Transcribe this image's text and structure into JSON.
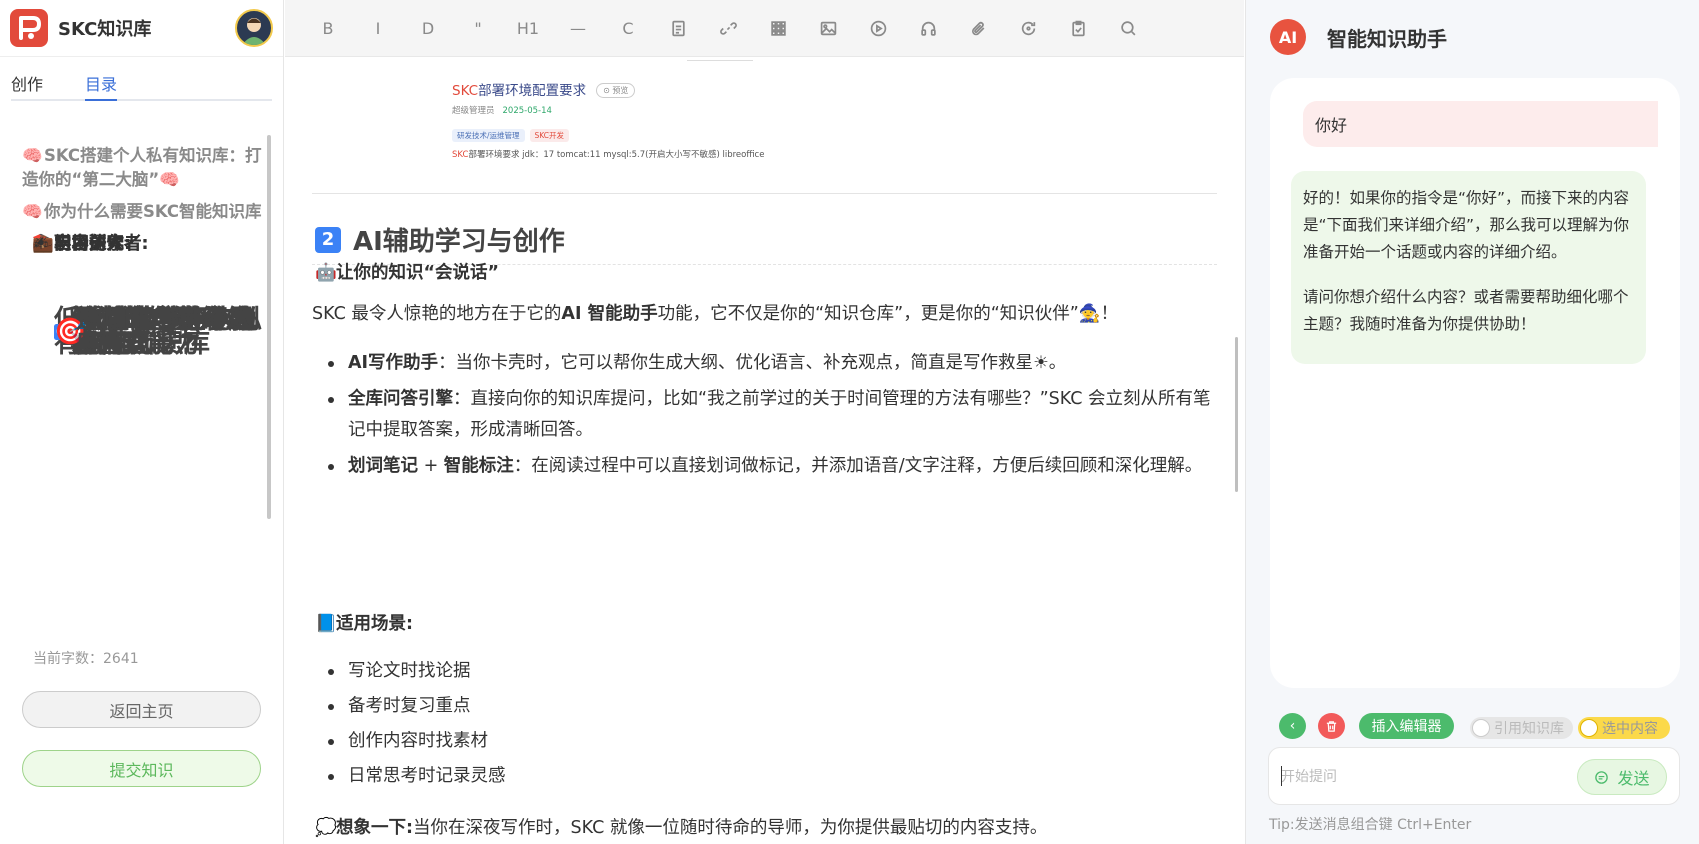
{
  "sidebar": {
    "brand": "SKC知识库",
    "tabs": [
      "创作",
      "目录"
    ],
    "toc": [
      {
        "text": "SKC搭建个人私有知识库：打造你的“第二大脑”",
        "level": "h1",
        "emoji": "🧠",
        "emoji_after": "🧠"
      },
      {
        "text": "低成本构建个人私有智能知识库",
        "level": "h2"
      },
      {
        "text": "你为什么需要SKC智能知识库",
        "level": "h1",
        "emoji": "🧠"
      },
      {
        "text": "强大的知识组织与检索能力",
        "level": "h2",
        "num": "1"
      },
      {
        "text": "AI辅助学习与创作",
        "level": "h2",
        "num": "2"
      },
      {
        "text": "灵活的创作与展示方式",
        "level": "h2",
        "num": "3"
      },
      {
        "text": "个性化与协作功能",
        "level": "h2",
        "num": "4"
      },
      {
        "text": "移动端与跨平台支持",
        "level": "h2",
        "num": "5"
      },
      {
        "text": "知识的全生命周期管理",
        "level": "h2",
        "num": "6"
      },
      {
        "text": "适用于哪些个人应用场景?",
        "level": "h2",
        "emoji": "🎯"
      },
      {
        "text": "学习研究者:",
        "level": "h3",
        "emoji": "📚"
      },
      {
        "text": "职场达人:",
        "level": "h3",
        "emoji": "💼"
      },
      {
        "text": "内容创作者:",
        "level": "h3",
        "emoji": "✍"
      },
      {
        "text": "自由探索者:",
        "level": "h3",
        "emoji": "☀"
      }
    ],
    "wordcount": "当前字数：2641",
    "home_button": "返回主页",
    "submit_button": "提交知识"
  },
  "toolbar": {
    "bold": "B",
    "italic": "I",
    "strike": "D",
    "quote": "\"",
    "heading": "H1",
    "hr": "—",
    "code": "C"
  },
  "embed": {
    "title_red": "SKC",
    "title_rest": "部署环境配置要求",
    "badge": "⊙ 预览",
    "author": "超级管理员",
    "date": "2025-05-14",
    "tags": [
      "研发技术/运维管理",
      "SKC开发"
    ],
    "req_red": "SKC",
    "req_rest": "部署环境要求 jdk：17 tomcat:11 mysql:5.7(开启大小写不敏感) libreoffice"
  },
  "article": {
    "h2_num": "2",
    "h2": "AI辅助学习与创作",
    "h3_talk_emoji": "🤖",
    "h3_talk": "让你的知识“会说话”",
    "intro_pre": "SKC 最令人惊艳的地方在于它的",
    "intro_bold": "AI 智能助手",
    "intro_post": "功能，它不仅是你的“知识仓库”，更是你的“知识伙伴”",
    "intro_emoji": "🧙",
    "intro_end": "！",
    "features": [
      {
        "bold": "AI写作助手",
        "text": "：当你卡壳时，它可以帮你生成大纲、优化语言、补充观点，简直是写作救星",
        "emoji": "☀",
        "end": "。"
      },
      {
        "bold": "全库问答引擎",
        "text": "：直接向你的知识库提问，比如“我之前学过的关于时间管理的方法有哪些？”SKC 会立刻从所有笔记中提取答案，形成清晰回答。",
        "emoji": "",
        "end": ""
      },
      {
        "bold": "划词笔记",
        "mid": " + ",
        "bold2": "智能标注",
        "text": "：在阅读过程中可以直接划词做标记，并添加语音/文字注释，方便后续回顾和深化理解。",
        "emoji": "",
        "end": ""
      }
    ],
    "h3_scene_emoji": "📘",
    "h3_scene": "适用场景:",
    "scenes": [
      "写论文时找论据",
      "备考时复习重点",
      "创作内容时找素材",
      "日常思考时记录灵感"
    ],
    "imagine_emoji": "💭",
    "imagine_bold": "想象一下:",
    "imagine_text": "当你在深夜写作时，SKC 就像一位随时待命的导师，为你提供最贴切的内容支持。"
  },
  "ai": {
    "badge": "AI",
    "title": "智能知识助手",
    "user_msg": "你好",
    "ai_p1": "好的！如果你的指令是“你好”，而接下来的内容是“下面我们来详细介绍”，那么我可以理解为你准备开始一个话题或内容的详细介绍。",
    "ai_p2": "请问你想介绍什么内容？或者需要帮助细化哪个主题？我随时准备为你提供协助！",
    "back": "‹",
    "delete": "🗑",
    "insert": "插入编辑器",
    "toggle_kb": "引用知识库",
    "toggle_sel": "选中内容",
    "input_placeholder": "开始提问",
    "send": "发送",
    "tip": "Tip:发送消息组合键  Ctrl+Enter"
  }
}
